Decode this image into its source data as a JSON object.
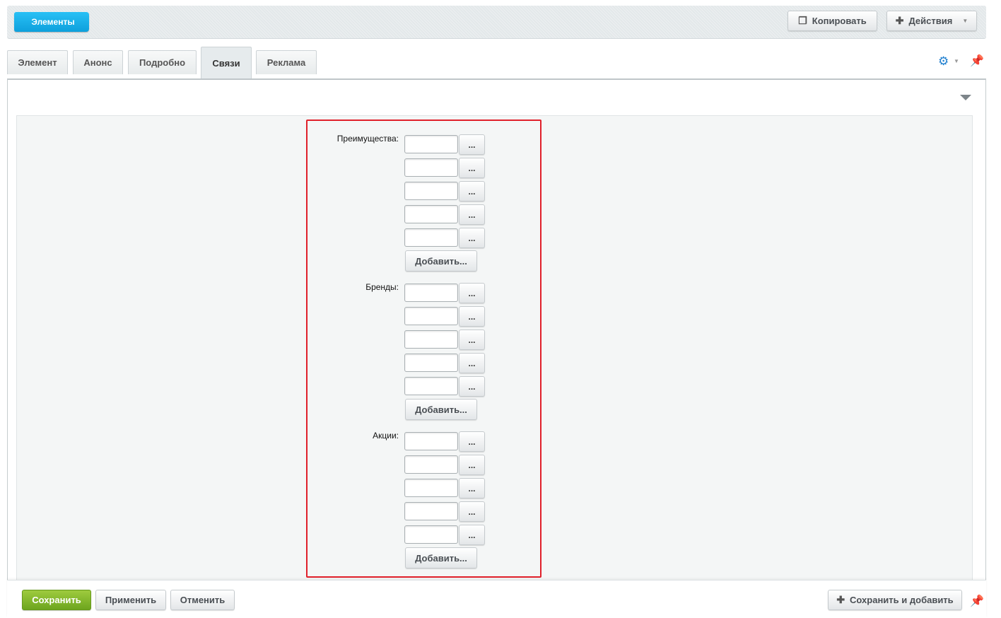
{
  "header": {
    "back_label": "Элементы",
    "copy_label": "Копировать",
    "actions_label": "Действия"
  },
  "tabs": [
    {
      "label": "Элемент",
      "active": false
    },
    {
      "label": "Анонс",
      "active": false
    },
    {
      "label": "Подробно",
      "active": false
    },
    {
      "label": "Связи",
      "active": true
    },
    {
      "label": "Реклама",
      "active": false
    }
  ],
  "fields": [
    {
      "label": "Преимущества:",
      "rows": 5,
      "button_label": "...",
      "add_label": "Добавить..."
    },
    {
      "label": "Бренды:",
      "rows": 5,
      "button_label": "...",
      "add_label": "Добавить..."
    },
    {
      "label": "Акции:",
      "rows": 5,
      "button_label": "...",
      "add_label": "Добавить..."
    }
  ],
  "footer": {
    "save_label": "Сохранить",
    "apply_label": "Применить",
    "cancel_label": "Отменить",
    "save_add_label": "Сохранить и добавить"
  },
  "colors": {
    "accent_blue": "#0ea0dc",
    "save_green": "#6da51e",
    "highlight_red": "#e0202a"
  },
  "icons": [
    "copy-icon",
    "plus-icon",
    "gear-icon",
    "pin-icon",
    "chevron-down-icon"
  ]
}
